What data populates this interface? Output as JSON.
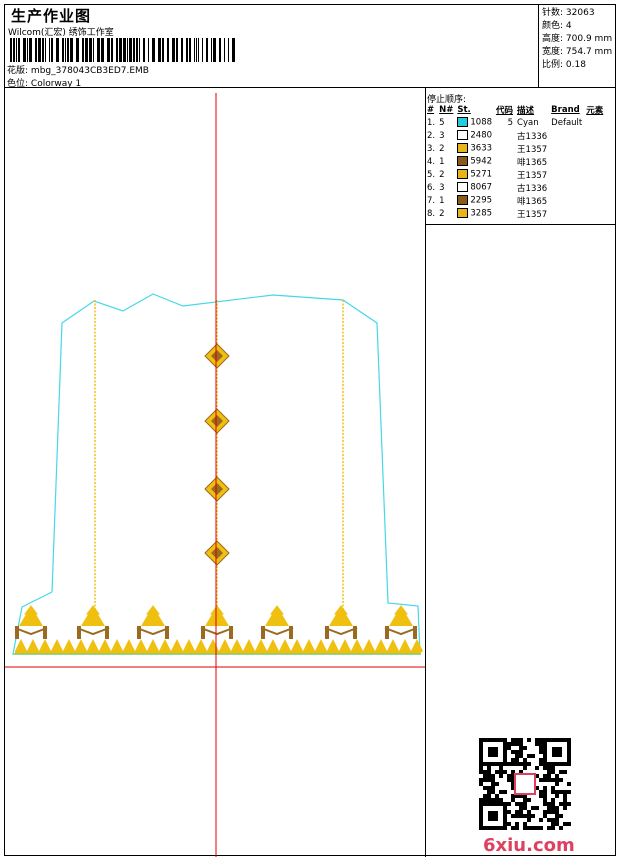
{
  "header": {
    "title": "生产作业图",
    "studio": "Wilcom(汇宏) 绣饰工作室",
    "design_label": "花版:",
    "design_file": "mbg_378043CB3ED7.EMB",
    "colorway_label": "色位:",
    "colorway": "Colorway 1"
  },
  "stats": [
    {
      "label": "针数:",
      "value": "32063"
    },
    {
      "label": "颜色:",
      "value": "4"
    },
    {
      "label": "高度:",
      "value": "700.9 mm"
    },
    {
      "label": "宽度:",
      "value": "754.7 mm"
    },
    {
      "label": "比例:",
      "value": "0.18"
    }
  ],
  "sequence": {
    "heading": "停止顺序:",
    "columns": [
      "#",
      "N#",
      "St.",
      "代码",
      "描述",
      "Brand",
      "元素"
    ],
    "rows": [
      {
        "n": "1.",
        "col": "5",
        "swatch": "#22ccdd",
        "st": "1088",
        "code": "5",
        "desc": "Cyan",
        "brand": "Default"
      },
      {
        "n": "2.",
        "col": "3",
        "swatch": "#ffffff",
        "st": "2480",
        "code": "",
        "desc": "古1336",
        "brand": ""
      },
      {
        "n": "3.",
        "col": "2",
        "swatch": "#e8b418",
        "st": "3633",
        "code": "",
        "desc": "王1357",
        "brand": ""
      },
      {
        "n": "4.",
        "col": "1",
        "swatch": "#8a5a18",
        "st": "5942",
        "code": "",
        "desc": "啡1365",
        "brand": ""
      },
      {
        "n": "5.",
        "col": "2",
        "swatch": "#e8b418",
        "st": "5271",
        "code": "",
        "desc": "王1357",
        "brand": ""
      },
      {
        "n": "6.",
        "col": "3",
        "swatch": "#ffffff",
        "st": "8067",
        "code": "",
        "desc": "古1336",
        "brand": ""
      },
      {
        "n": "7.",
        "col": "1",
        "swatch": "#8a5a18",
        "st": "2295",
        "code": "",
        "desc": "啡1365",
        "brand": ""
      },
      {
        "n": "8.",
        "col": "2",
        "swatch": "#e8b418",
        "st": "3285",
        "code": "",
        "desc": "王1357",
        "brand": ""
      }
    ]
  },
  "watermark": "6xiu.com",
  "colors": {
    "outline": "#44d8e8",
    "gold": "#f0c010",
    "brown": "#9a6a20",
    "axis": "#dd0000",
    "logo": "#e04060"
  }
}
